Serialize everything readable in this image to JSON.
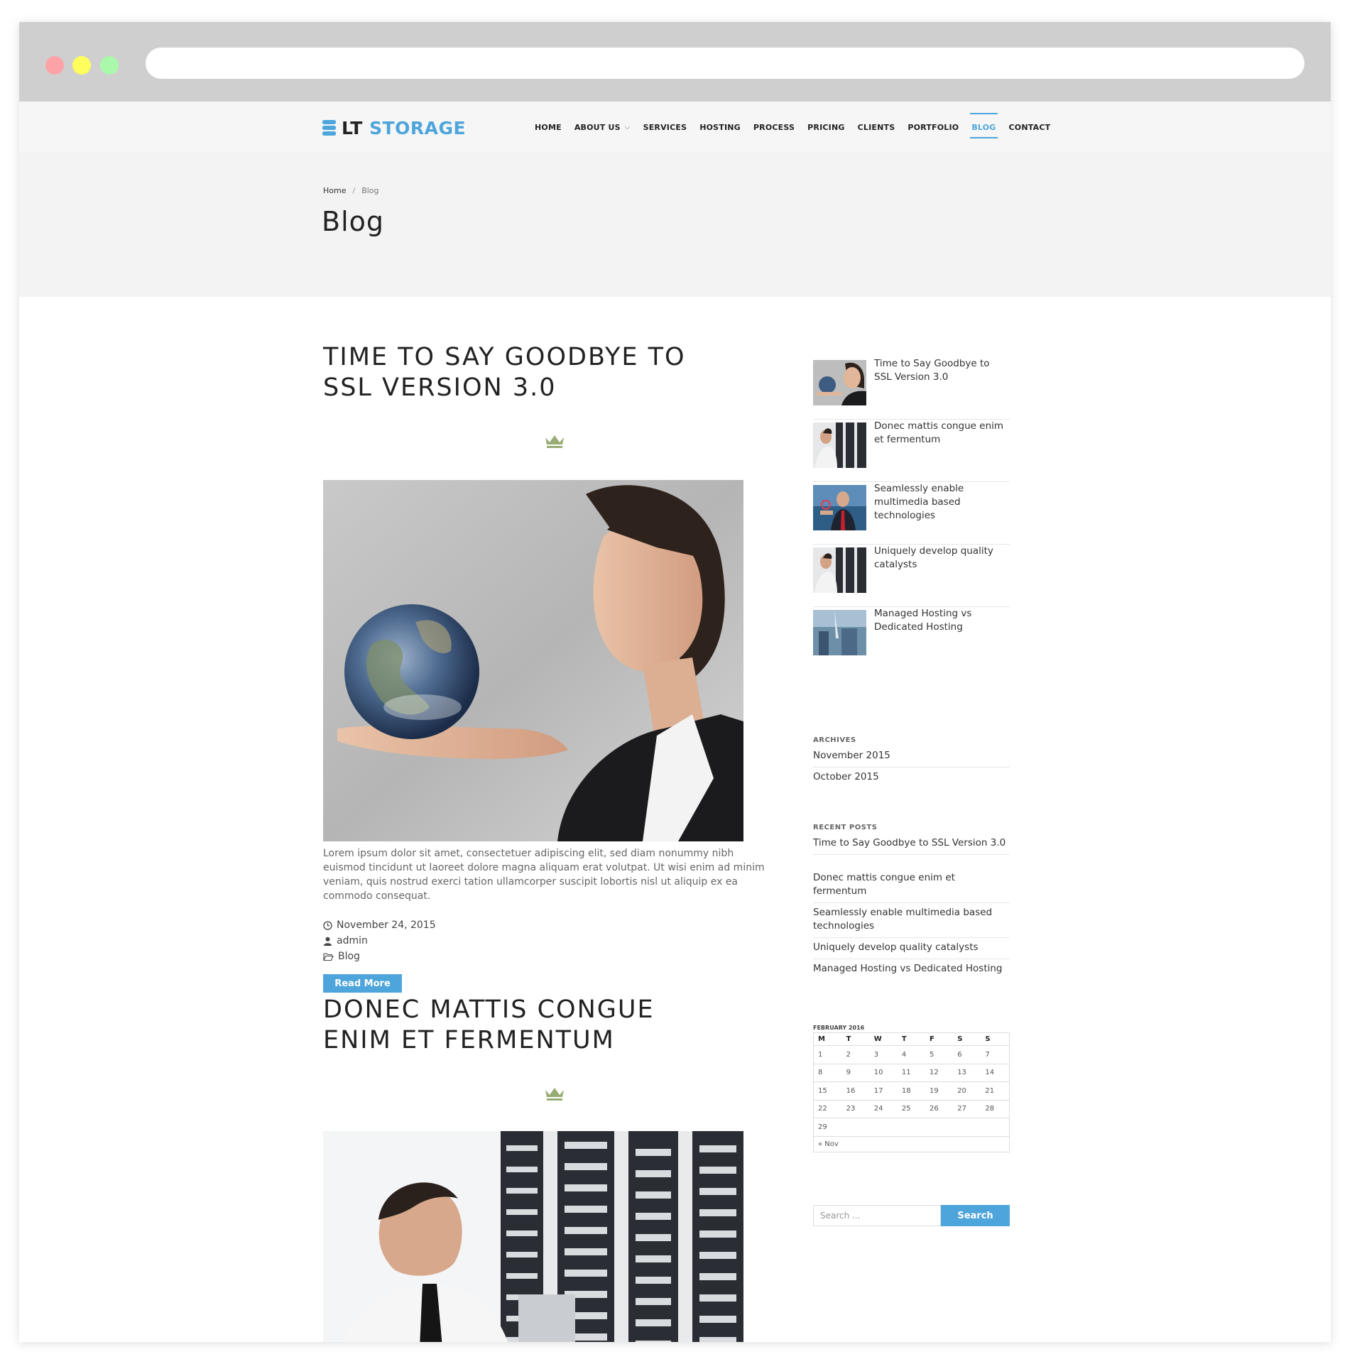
{
  "brand": {
    "name_part1": "LT",
    "name_part2": "STORAGE",
    "accent_color": "#4ea5dc",
    "icon": "database-stack-icon"
  },
  "nav": {
    "items": [
      {
        "label": "HOME"
      },
      {
        "label": "ABOUT US",
        "has_dropdown": true
      },
      {
        "label": "SERVICES"
      },
      {
        "label": "HOSTING"
      },
      {
        "label": "PROCESS"
      },
      {
        "label": "PRICING"
      },
      {
        "label": "CLIENTS"
      },
      {
        "label": "PORTFOLIO"
      },
      {
        "label": "BLOG",
        "active": true
      },
      {
        "label": "CONTACT"
      }
    ]
  },
  "breadcrumb": {
    "home": "Home",
    "separator": "/",
    "current": "Blog"
  },
  "page": {
    "title": "Blog"
  },
  "posts": [
    {
      "title_line1": "TIME TO SAY GOODBYE TO",
      "title_line2": "SSL VERSION 3.0",
      "excerpt": "Lorem ipsum dolor sit amet, consectetuer adipiscing elit, sed diam nonummy nibh euismod tincidunt ut laoreet dolore magna aliquam erat volutpat. Ut wisi enim ad minim veniam, quis nostrud exerci tation ullamcorper suscipit lobortis nisl ut aliquip ex ea commodo consequat.",
      "date": "November 24, 2015",
      "author": "admin",
      "category": "Blog",
      "read_more": "Read More"
    },
    {
      "title_line1": "DONEC MATTIS CONGUE",
      "title_line2": "ENIM ET FERMENTUM"
    }
  ],
  "sidebar": {
    "featured_posts": [
      {
        "title": "Time to Say Goodbye to SSL Version 3.0"
      },
      {
        "title": "Donec mattis congue enim et fermentum"
      },
      {
        "title": "Seamlessly enable multimedia based technologies"
      },
      {
        "title": "Uniquely develop quality catalysts"
      },
      {
        "title": "Managed Hosting vs Dedicated Hosting"
      }
    ],
    "archives": {
      "title": "ARCHIVES",
      "items": [
        "November 2015",
        "October 2015"
      ]
    },
    "recent_posts": {
      "title": "RECENT POSTS",
      "items": [
        "Time to Say Goodbye to SSL Version 3.0",
        "Donec mattis congue enim et fermentum",
        "Seamlessly enable multimedia based technologies",
        "Uniquely develop quality catalysts",
        "Managed Hosting vs Dedicated Hosting"
      ]
    },
    "calendar": {
      "caption": "FEBRUARY 2016",
      "weekdays": [
        "M",
        "T",
        "W",
        "T",
        "F",
        "S",
        "S"
      ],
      "weeks": [
        [
          "1",
          "2",
          "3",
          "4",
          "5",
          "6",
          "7"
        ],
        [
          "8",
          "9",
          "10",
          "11",
          "12",
          "13",
          "14"
        ],
        [
          "15",
          "16",
          "17",
          "18",
          "19",
          "20",
          "21"
        ],
        [
          "22",
          "23",
          "24",
          "25",
          "26",
          "27",
          "28"
        ],
        [
          "29",
          "",
          "",
          "",
          "",
          "",
          ""
        ]
      ],
      "prev": "« Nov"
    },
    "search": {
      "placeholder": "Search ...",
      "button": "Search"
    }
  }
}
